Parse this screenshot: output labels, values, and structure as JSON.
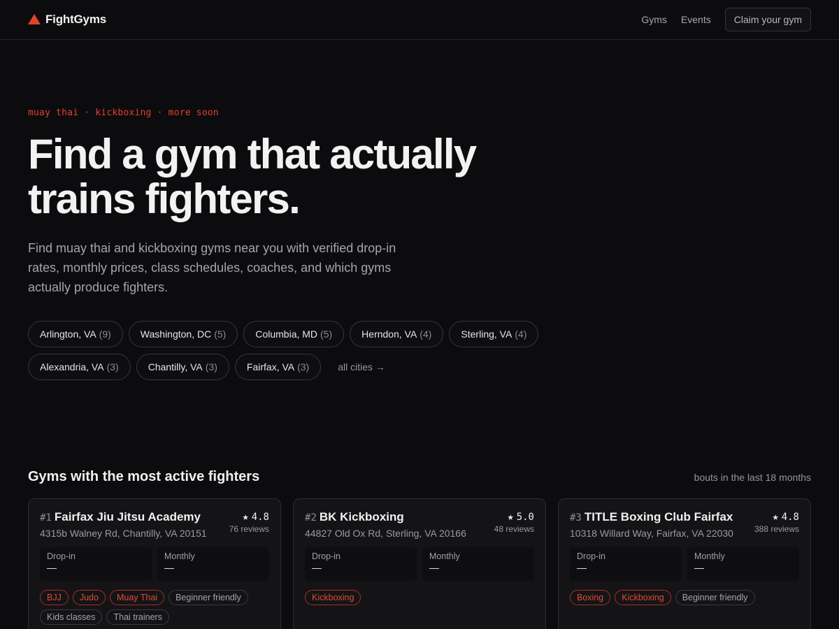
{
  "header": {
    "brand": "FightGyms",
    "nav": [
      "Gyms",
      "Events"
    ],
    "cta": "Claim your gym"
  },
  "hero": {
    "eyebrow": "muay thai · kickboxing · more soon",
    "title_line1": "Find a gym that actually",
    "title_line2": "trains fighters.",
    "subtitle": "Find muay thai and kickboxing gyms near you with verified drop-in rates, monthly prices, class schedules, coaches, and which gyms actually produce fighters.",
    "cities": [
      {
        "name": "Arlington, VA",
        "count": "(9)"
      },
      {
        "name": "Washington, DC",
        "count": "(5)"
      },
      {
        "name": "Columbia, MD",
        "count": "(5)"
      },
      {
        "name": "Herndon, VA",
        "count": "(4)"
      },
      {
        "name": "Sterling, VA",
        "count": "(4)"
      },
      {
        "name": "Alexandria, VA",
        "count": "(3)"
      },
      {
        "name": "Chantilly, VA",
        "count": "(3)"
      },
      {
        "name": "Fairfax, VA",
        "count": "(3)"
      }
    ],
    "all_cities": "all cities →"
  },
  "section": {
    "title": "Gyms with the most active fighters",
    "note": "bouts in the last 18 months"
  },
  "colors": {
    "accent": "#e0422c",
    "background": "#0c0c0e",
    "card": "#141417"
  },
  "gyms": [
    {
      "rank": "#1",
      "name": "Fairfax Jiu Jitsu Academy",
      "address": "4315b Walney Rd, Chantilly, VA 20151",
      "rating": "4.8",
      "reviews": "76 reviews",
      "dropin_label": "Drop-in",
      "dropin": "—",
      "monthly_label": "Monthly",
      "monthly": "—",
      "tags": [
        {
          "text": "BJJ",
          "kind": "sport"
        },
        {
          "text": "Judo",
          "kind": "sport"
        },
        {
          "text": "Muay Thai",
          "kind": "sport"
        },
        {
          "text": "Beginner friendly",
          "kind": "feature"
        },
        {
          "text": "Kids classes",
          "kind": "feature"
        },
        {
          "text": "Thai trainers",
          "kind": "feature"
        }
      ]
    },
    {
      "rank": "#2",
      "name": "BK Kickboxing",
      "address": "44827 Old Ox Rd, Sterling, VA 20166",
      "rating": "5.0",
      "reviews": "48 reviews",
      "dropin_label": "Drop-in",
      "dropin": "—",
      "monthly_label": "Monthly",
      "monthly": "—",
      "tags": [
        {
          "text": "Kickboxing",
          "kind": "sport"
        }
      ]
    },
    {
      "rank": "#3",
      "name": "TITLE Boxing Club Fairfax",
      "address": "10318 Willard Way, Fairfax, VA 22030",
      "rating": "4.8",
      "reviews": "388 reviews",
      "dropin_label": "Drop-in",
      "dropin": "—",
      "monthly_label": "Monthly",
      "monthly": "—",
      "tags": [
        {
          "text": "Boxing",
          "kind": "sport"
        },
        {
          "text": "Kickboxing",
          "kind": "sport"
        },
        {
          "text": "Beginner friendly",
          "kind": "feature"
        }
      ]
    }
  ]
}
